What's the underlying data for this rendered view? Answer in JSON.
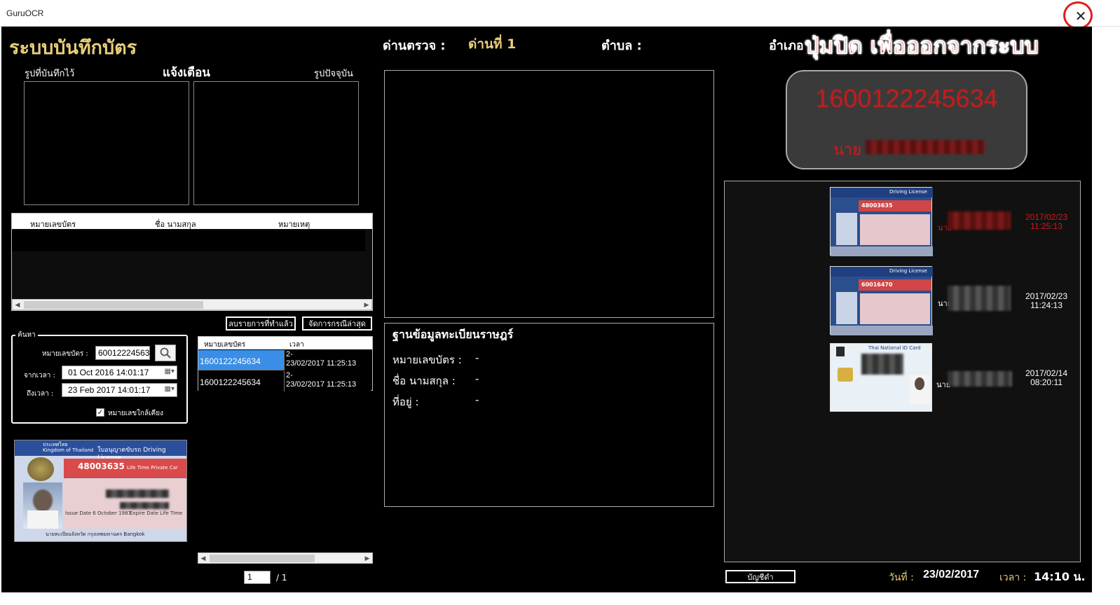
{
  "window": {
    "title": "GuruOCR",
    "close_symbol": "✕"
  },
  "annotation": {
    "close_hint": "ปุ่มปิด เพื่อออกจากระบบ",
    "color": "#e21d1d"
  },
  "header": {
    "app_title": "ระบบบันทึกบัตร",
    "checkpoint_label": "ด่านตรวจ :",
    "checkpoint_value": "ด่านที่ 1",
    "subdistrict_label": "ตำบล :",
    "district_label": "อำเภอ"
  },
  "left": {
    "saved_image_label": "รูปที่บันทึกไว้",
    "alert_label": "แจ้งเตือน",
    "current_image_label": "รูปปัจจุบัน",
    "alert_table": {
      "columns": [
        "หมายเลขบัตร",
        "ชื่อ นามสกุล",
        "หมายเหตุ"
      ]
    },
    "delete_done_button": "ลบรายการที่ทำแล้ว",
    "manage_latest_button": "จัดการกรณีล่าสุด",
    "search": {
      "legend": "ค้นหา",
      "card_number_label": "หมายเลขบัตร :",
      "card_number_value": "600122245634",
      "from_label": "จากเวลา :",
      "from_value": "01 Oct  2016   14:01:17",
      "to_label": "ถึงเวลา :",
      "to_value": "23 Feb  2017   14:01:17",
      "nearby_checkbox_label": "หมายเลขใกล้เคียง",
      "nearby_checked": true
    },
    "results_table": {
      "columns": [
        "หมายเลขบัตร",
        "เวลา"
      ],
      "rows": [
        {
          "card": "1600122245634",
          "time_line1": "2-",
          "time_line2": "23/02/2017 11:25:13",
          "selected": true
        },
        {
          "card": "1600122245634",
          "time_line1": "2-",
          "time_line2": "23/02/2017 11:25:13",
          "selected": false
        }
      ]
    },
    "license_preview": {
      "country_th": "ประเทศไทย",
      "country_en": "Kingdom of Thailand",
      "title": "ใบอนุญาตขับรถ Driving License",
      "number": "48003635",
      "type": "Life Time Private Car",
      "issue": "Issue Date  6 October 1987",
      "expire": "Expire Date  Life Time",
      "footer": "นายทะเบียนจังหวัด กรุงเทพมหานคร Bangkok"
    },
    "pager": {
      "page": "1",
      "total": "/ 1"
    }
  },
  "center": {
    "registry_title": "ฐานข้อมูลทะเบียนราษฎร์",
    "fields": [
      {
        "label": "หมายเลขบัตร :",
        "value": "-"
      },
      {
        "label": "ชื่อ นามสกุล :",
        "value": "-"
      },
      {
        "label": "ที่อยู่ :",
        "value": "-"
      }
    ]
  },
  "right": {
    "display": {
      "number": "1600122245634",
      "name_prefix": "นาย"
    },
    "history": [
      {
        "card_title": "Driving License",
        "card_no": "48003635",
        "name_prefix": "นาย",
        "date": "2017/02/23",
        "time": "11:25:13",
        "highlight": true
      },
      {
        "card_title": "Driving License",
        "card_no": "60016470",
        "name_prefix": "นาย",
        "date": "2017/02/23",
        "time": "11:24:13",
        "highlight": false
      },
      {
        "card_title": "Thai National ID Card",
        "card_no": "",
        "name_prefix": "นาย",
        "date": "2017/02/14",
        "time": "08:20:11",
        "highlight": false
      }
    ],
    "blacklist_button": "บัญชีดำ",
    "date_label": "วันที่ :",
    "date_value": "23/02/2017",
    "time_label": "เวลา :",
    "time_value": "14:10 น."
  }
}
